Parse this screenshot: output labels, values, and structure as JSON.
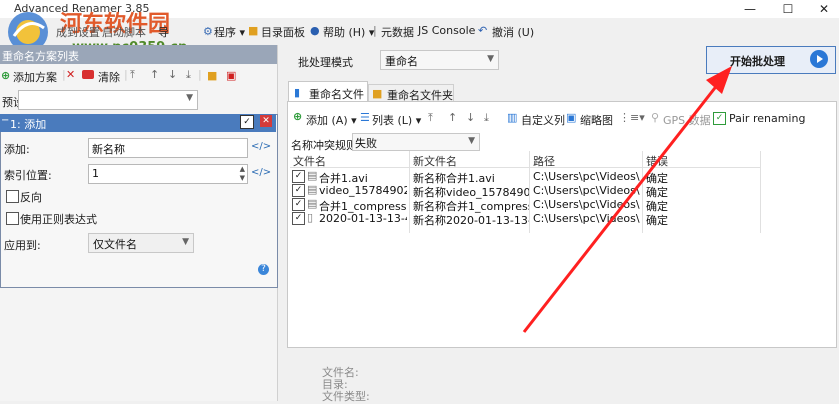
{
  "window": {
    "title": "Advanced Renamer 3.85",
    "controls": {
      "minimize": "—",
      "maximize": "☐",
      "close": "✕"
    }
  },
  "watermark": {
    "line1": "河东软件园",
    "line2": "www.pc0359.cn"
  },
  "menu": {
    "items": [
      {
        "label": "程序",
        "arrow": "▾"
      },
      {
        "label": "目录面板"
      },
      {
        "label": "帮助 (H)",
        "arrow": "▾"
      },
      {
        "label": "元数据"
      },
      {
        "label": "JS Console"
      },
      {
        "label": "撤消 (U)"
      }
    ],
    "partial_left": [
      "成到设置",
      "启动脚本",
      "导"
    ]
  },
  "left_panel": {
    "header": "重命名方案列表",
    "toolbar": {
      "add": "添加方案",
      "clear": "清除"
    },
    "preset_label": "预设:",
    "preset_value": "",
    "method": {
      "title": "1: 添加",
      "add_label": "添加:",
      "add_value": "新名称",
      "index_label": "索引位置:",
      "index_value": "1",
      "reverse_label": "反向",
      "regex_label": "使用正则表达式",
      "apply_label": "应用到:",
      "apply_value": "仅文件名",
      "help": "?"
    }
  },
  "right_panel": {
    "mode_label": "批处理模式",
    "mode_value": "重命名",
    "batch_button": "开始批处理",
    "tabs": [
      {
        "label": "重命名文件"
      },
      {
        "label": "重命名文件夹"
      }
    ],
    "toolbar": {
      "add": "添加 (A)",
      "list": "列表 (L)",
      "custom_columns": "自定义列",
      "thumbnail": "缩略图",
      "gps": "GPS 数据",
      "pair": "Pair renaming"
    },
    "conflict_label": "名称冲突规则:",
    "conflict_value": "失败",
    "columns": [
      "文件名",
      "新文件名",
      "路径",
      "错误"
    ],
    "rows": [
      {
        "file": "合并1.avi",
        "new": "新名称合并1.avi",
        "path": "C:\\Users\\pc\\Videos\\",
        "status": "确定"
      },
      {
        "file": "video_1578490209...",
        "new": "新名称video_157849020...",
        "path": "C:\\Users\\pc\\Videos\\",
        "status": "确定"
      },
      {
        "file": "合并1_compressed...",
        "new": "新名称合并1_compresse...",
        "path": "C:\\Users\\pc\\Videos\\",
        "status": "确定"
      },
      {
        "file": "2020-01-13-13-47-...",
        "new": "新名称2020-01-13-13-47...",
        "path": "C:\\Users\\pc\\Videos\\",
        "status": "确定"
      }
    ],
    "info": {
      "filename": "文件名:",
      "folder": "目录:",
      "filetype": "文件类型:"
    }
  },
  "colors": {
    "accent": "#4a7bbd",
    "arrow": "#ff2020",
    "watermark_red": "#e15a2b",
    "watermark_green": "#4f8a2a"
  }
}
